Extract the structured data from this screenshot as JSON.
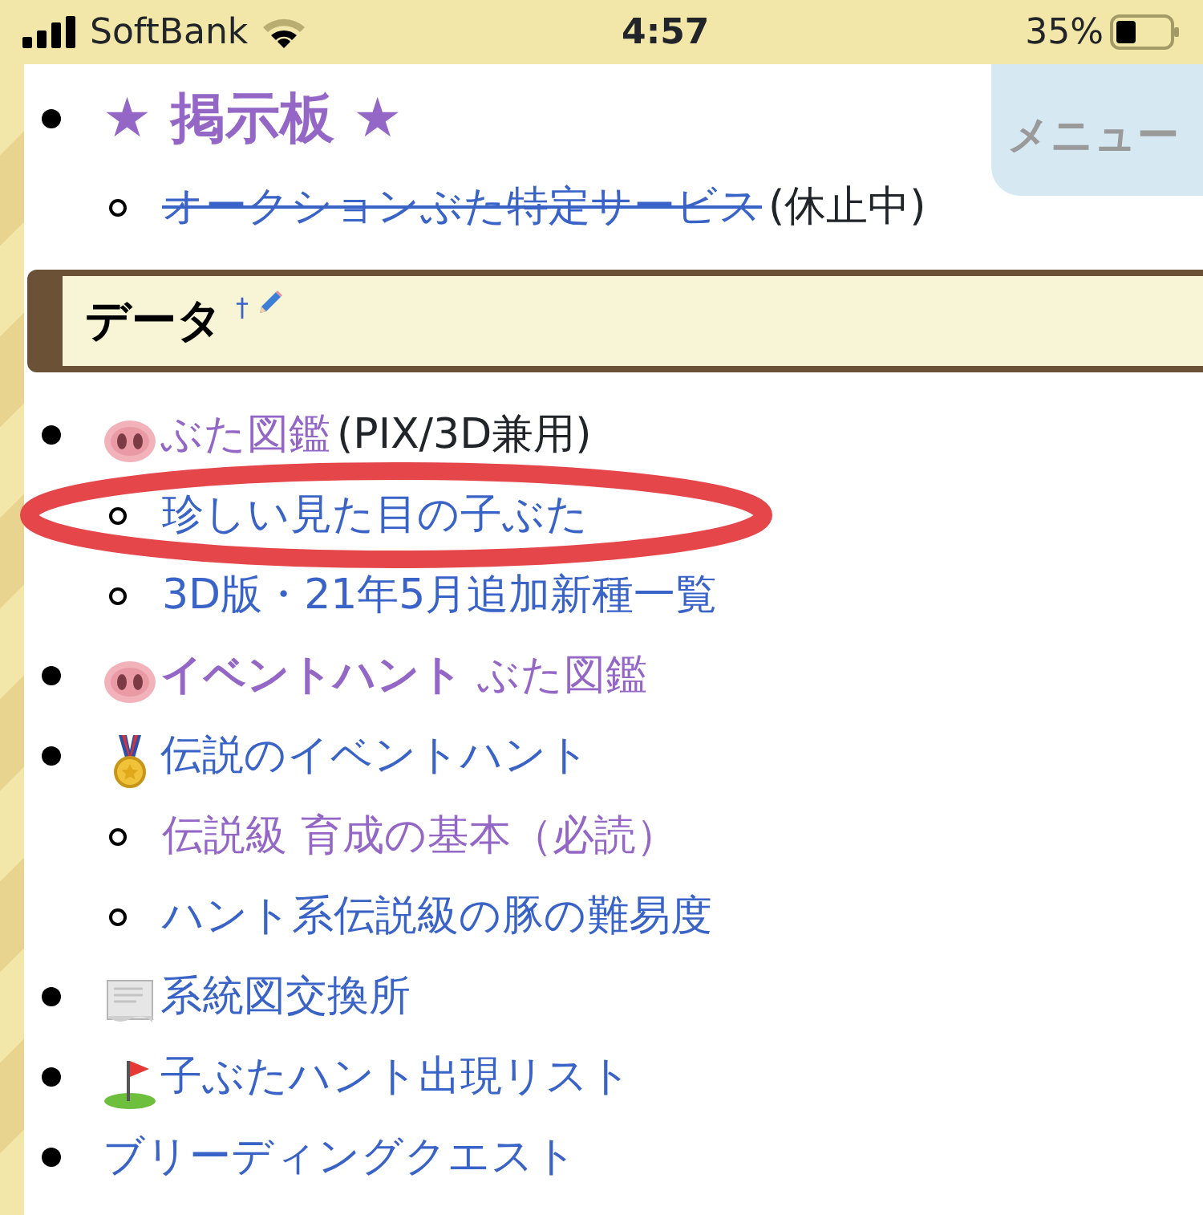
{
  "status_bar": {
    "carrier": "SoftBank",
    "time": "4:57",
    "battery": "35%"
  },
  "menu_tab": {
    "label": "メニュー"
  },
  "board": {
    "title": "★ 掲示板 ★",
    "children": [
      {
        "link": "オークションぶた特定サービス",
        "struck": true,
        "visited": false,
        "note": "(休止中)"
      }
    ]
  },
  "data_heading": {
    "title": "データ",
    "mark": "†"
  },
  "data_items": [
    {
      "kind": "pig",
      "link": "ぶた図鑑",
      "visited": true,
      "note": "(PIX/3D兼用)",
      "children": [
        {
          "link": "珍しい見た目の子ぶた",
          "visited": false
        },
        {
          "link": "3D版・21年5月追加新種一覧",
          "visited": false
        }
      ]
    },
    {
      "kind": "pig",
      "link": "**イベントハント** ぶた図鑑",
      "visited": true
    },
    {
      "kind": "medal",
      "link": "伝説のイベントハント",
      "visited": false,
      "children": [
        {
          "link": "伝説級 育成の基本（必読）",
          "visited": true
        },
        {
          "link": "ハント系伝説級の豚の難易度",
          "visited": false
        }
      ]
    },
    {
      "kind": "scroll",
      "link": "系統図交換所",
      "visited": false
    },
    {
      "kind": "flag",
      "link": "子ぶたハント出現リスト",
      "visited": false
    },
    {
      "kind": "plain",
      "link": "ブリーディングクエスト",
      "visited": false
    }
  ]
}
